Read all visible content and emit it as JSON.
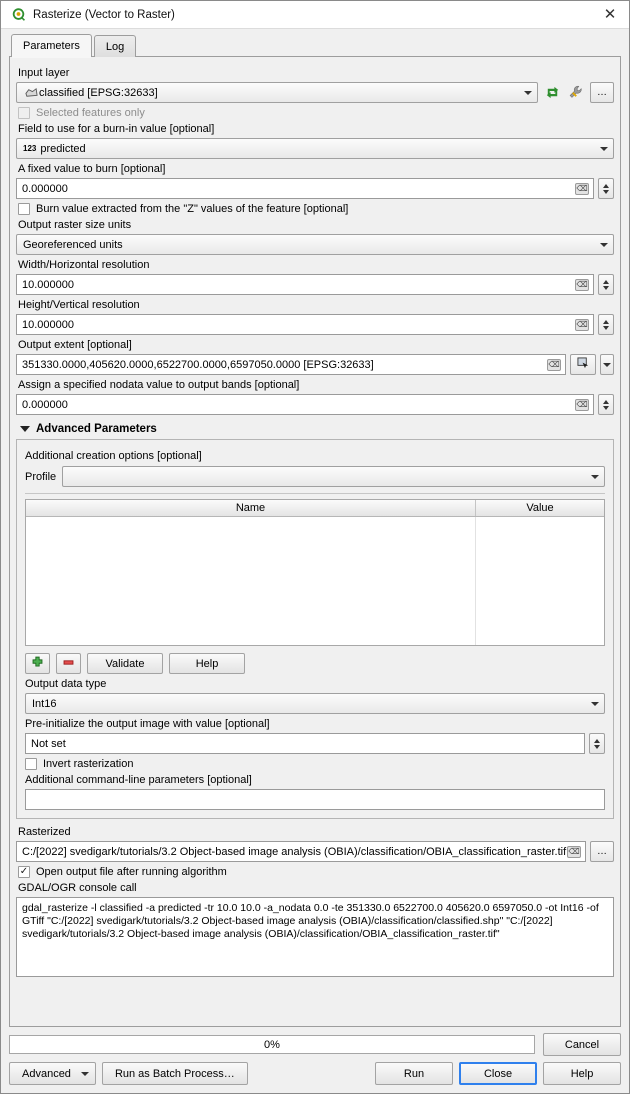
{
  "window": {
    "title": "Rasterize (Vector to Raster)",
    "icon": "qgis-logo-icon",
    "close_label": "✕"
  },
  "tabs": [
    {
      "label": "Parameters",
      "active": true
    },
    {
      "label": "Log",
      "active": false
    }
  ],
  "parameters": {
    "input_layer": {
      "label": "Input layer",
      "value": "classified [EPSG:32633]",
      "iterate_icon": "iterate-refresh-icon",
      "datadefined_icon": "wrench-icon",
      "browse_label": "…"
    },
    "selected_features_only": {
      "label": "Selected features only",
      "checked": false,
      "enabled": false
    },
    "burn_field": {
      "label": "Field to use for a burn-in value [optional]",
      "value": "predicted",
      "type_badge": "123"
    },
    "fixed_value": {
      "label": "A fixed value to burn [optional]",
      "value": "0.000000"
    },
    "burn_from_z": {
      "label": "Burn value extracted from the \"Z\" values of the feature [optional]",
      "checked": false
    },
    "size_units": {
      "label": "Output raster size units",
      "value": "Georeferenced units"
    },
    "width_res": {
      "label": "Width/Horizontal resolution",
      "value": "10.000000"
    },
    "height_res": {
      "label": "Height/Vertical resolution",
      "value": "10.000000"
    },
    "output_extent": {
      "label": "Output extent [optional]",
      "value": "351330.0000,405620.0000,6522700.0000,6597050.0000 [EPSG:32633]",
      "pick_icon": "extent-select-icon"
    },
    "nodata_value": {
      "label": "Assign a specified nodata value to output bands [optional]",
      "value": "0.000000"
    }
  },
  "advanced": {
    "header": "Advanced Parameters",
    "expanded": true,
    "creation_options_label": "Additional creation options [optional]",
    "profile": {
      "label": "Profile",
      "value": ""
    },
    "table": {
      "columns": [
        "Name",
        "Value"
      ],
      "rows": []
    },
    "add_button": "+",
    "remove_button": "−",
    "validate_button": "Validate",
    "help_button": "Help",
    "output_data_type": {
      "label": "Output data type",
      "value": "Int16"
    },
    "pre_initialize": {
      "label": "Pre-initialize the output image with value [optional]",
      "value": "Not set"
    },
    "invert_rasterization": {
      "label": "Invert rasterization",
      "checked": false
    },
    "extra_params": {
      "label": "Additional command-line parameters [optional]",
      "value": ""
    }
  },
  "output": {
    "label": "Rasterized",
    "path": "C:/[2022] svedigark/tutorials/3.2 Object-based image analysis (OBIA)/classification/OBIA_classification_raster.tif",
    "browse_label": "…",
    "open_after": {
      "label": "Open output file after running algorithm",
      "checked": true
    },
    "console_label": "GDAL/OGR console call",
    "console_call": "gdal_rasterize -l classified -a predicted -tr 10.0 10.0 -a_nodata 0.0 -te 351330.0 6522700.0 405620.0 6597050.0 -ot Int16 -of GTiff \"C:/[2022] svedigark/tutorials/3.2 Object-based image analysis (OBIA)/classification/classified.shp\" \"C:/[2022] svedigark/tutorials/3.2 Object-based image analysis (OBIA)/classification/OBIA_classification_raster.tif\""
  },
  "footer": {
    "progress_text": "0%",
    "progress_percent": 0,
    "cancel_button": "Cancel",
    "advanced_button": "Advanced",
    "batch_button": "Run as Batch Process…",
    "run_button": "Run",
    "close_button": "Close",
    "help_button": "Help"
  },
  "colors": {
    "accent_green": "#2f8f2f",
    "focus_blue": "#2f80ed",
    "dialog_bg": "#f0f0f0",
    "field_bg": "#ffffff"
  }
}
